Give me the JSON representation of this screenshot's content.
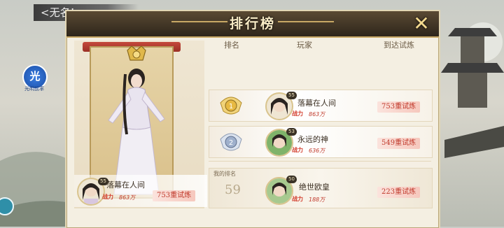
{
  "top_bar": {
    "text": "<无名!"
  },
  "side_badge": {
    "char": "光",
    "label": "光明前率"
  },
  "panel": {
    "title": "排行榜",
    "close_icon": "close-x-icon",
    "columns": [
      "排名",
      "玩家",
      "到达试炼"
    ]
  },
  "featured": {
    "name": "落幕在人间",
    "level": "55",
    "power": "863万",
    "stage": "753重试炼"
  },
  "rows": [
    {
      "rank": "1",
      "medal": "gold-medal-icon",
      "name": "落幕在人间",
      "level": "55",
      "power": "863万",
      "stage": "753重试炼"
    },
    {
      "rank": "2",
      "medal": "silver-medal-icon",
      "name": "永远的神",
      "level": "53",
      "power": "636万",
      "stage": "549重试炼"
    }
  ],
  "my_rank": {
    "label": "我的排名",
    "rank": "59",
    "name": "绝世欧皇",
    "level": "50",
    "power": "188万",
    "stage": "223重试炼"
  },
  "colors": {
    "accent_red": "#c0392b",
    "gold": "#c8a865",
    "title_dark": "#2e261b"
  }
}
